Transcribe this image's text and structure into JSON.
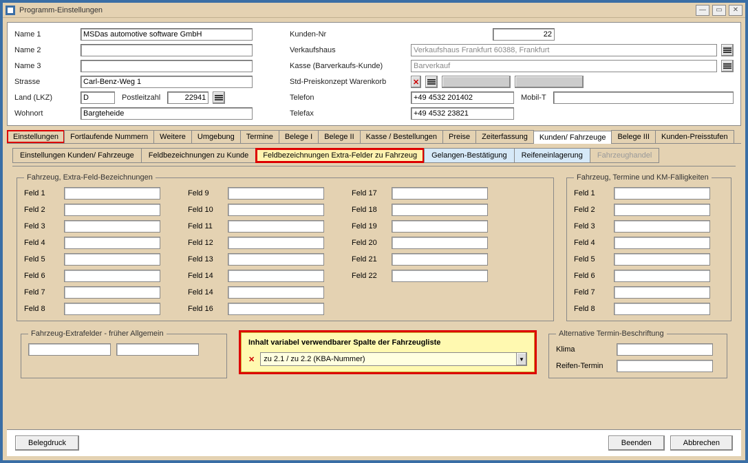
{
  "window": {
    "title": "Programm-Einstellungen"
  },
  "header": {
    "labels": {
      "name1": "Name 1",
      "name2": "Name 2",
      "name3": "Name 3",
      "strasse": "Strasse",
      "land": "Land (LKZ)",
      "plz": "Postleitzahl",
      "wohnort": "Wohnort",
      "kundennr": "Kunden-Nr",
      "verkaufshaus": "Verkaufshaus",
      "kasse": "Kasse (Barverkaufs-Kunde)",
      "preiskonzept": "Std-Preiskonzept Warenkorb",
      "telefon": "Telefon",
      "mobil": "Mobil-T",
      "telefax": "Telefax"
    },
    "values": {
      "name1": "MSDas automotive software GmbH",
      "name2": "",
      "name3": "",
      "strasse": "Carl-Benz-Weg 1",
      "land": "D",
      "plz": "22941",
      "wohnort": "Bargteheide",
      "kundennr": "22",
      "verkaufshaus": "Verkaufshaus Frankfurt 60388, Frankfurt",
      "kasse": "Barverkauf",
      "telefon": "+49 4532 201402",
      "mobil": "",
      "telefax": "+49 4532 23821"
    }
  },
  "tabs": {
    "main": [
      "Einstellungen",
      "Fortlaufende Nummern",
      "Weitere",
      "Umgebung",
      "Termine",
      "Belege I",
      "Belege II",
      "Kasse / Bestellungen",
      "Preise",
      "Zeiterfassung",
      "Kunden/ Fahrzeuge",
      "Belege III",
      "Kunden-Preisstufen"
    ],
    "sub": [
      "Einstellungen Kunden/ Fahrzeuge",
      "Feldbezeichnungen zu Kunde",
      "Feldbezeichnungen Extra-Felder zu Fahrzeug",
      "Gelangen-Bestätigung",
      "Reifeneinlagerung",
      "Fahrzeughandel"
    ]
  },
  "groups": {
    "extra_felder": "Fahrzeug, Extra-Feld-Bezeichnungen",
    "termine_km": "Fahrzeug, Termine und KM-Fälligkeiten",
    "frueher_allg": "Fahrzeug-Extrafelder - früher Allgemein",
    "variabel": "Inhalt variabel verwendbarer Spalte der Fahrzeugliste",
    "alt_termin": "Alternative Termin-Beschriftung"
  },
  "fields": {
    "col1": [
      "Feld 1",
      "Feld 2",
      "Feld 3",
      "Feld 4",
      "Feld 5",
      "Feld 6",
      "Feld 7",
      "Feld 8"
    ],
    "col2": [
      "Feld 9",
      "Feld 10",
      "Feld 11",
      "Feld 12",
      "Feld 13",
      "Feld 14",
      "Feld 14",
      "Feld 16"
    ],
    "col3": [
      "Feld 17",
      "Feld 18",
      "Feld 19",
      "Feld 20",
      "Feld 21",
      "Feld 22"
    ],
    "km": [
      "Feld 1",
      "Feld 2",
      "Feld 3",
      "Feld 4",
      "Feld 5",
      "Feld 6",
      "Feld 7",
      "Feld 8"
    ]
  },
  "variabel_combo": "zu 2.1 / zu 2.2 (KBA-Nummer)",
  "alt_termin": {
    "klima": "Klima",
    "reifen": "Reifen-Termin"
  },
  "buttons": {
    "belegdruck": "Belegdruck",
    "beenden": "Beenden",
    "abbrechen": "Abbrechen"
  }
}
